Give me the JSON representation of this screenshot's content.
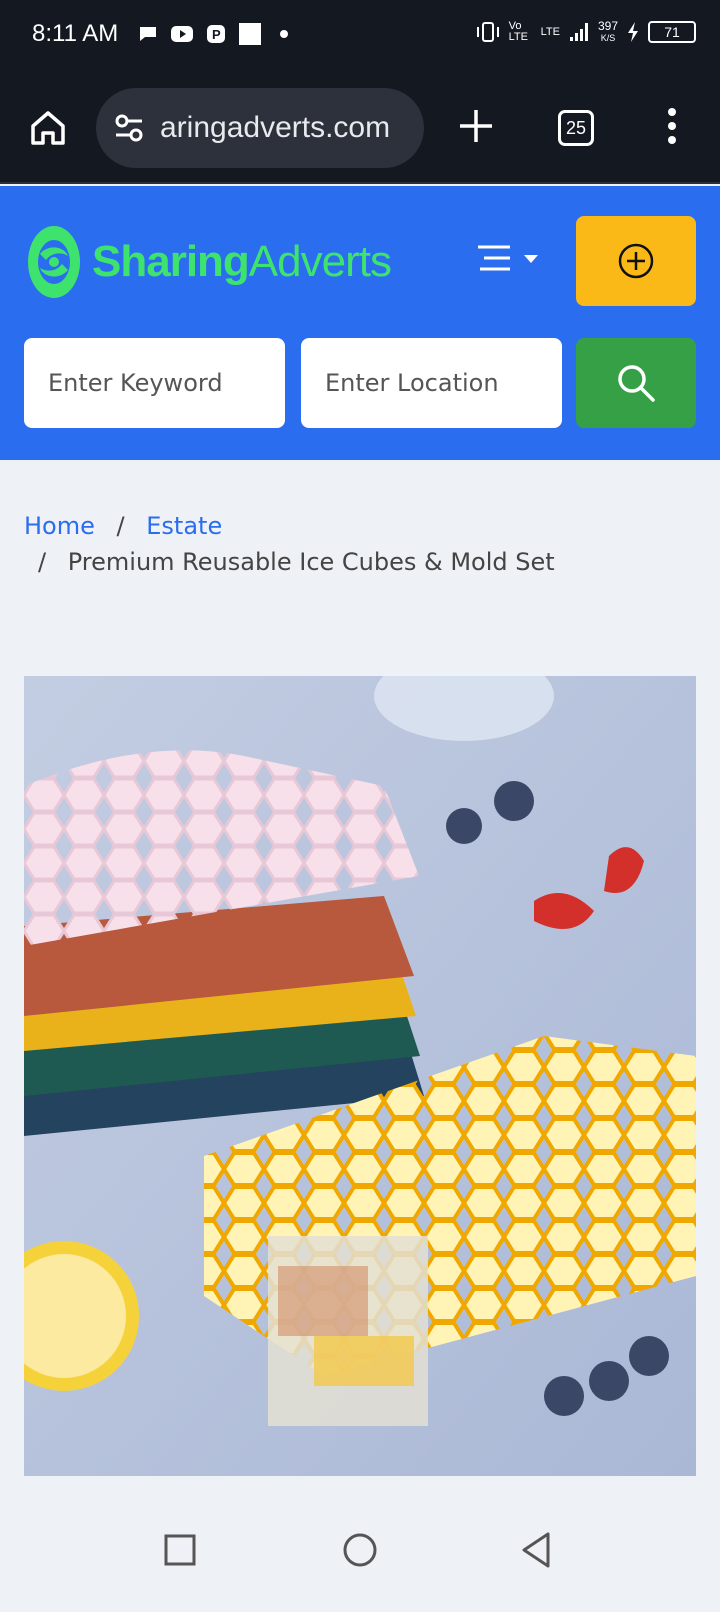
{
  "status": {
    "time": "8:11 AM",
    "battery": "71",
    "speed_value": "397",
    "speed_unit": "K/S",
    "network_1": "Vo LTE",
    "network_2": "LTE"
  },
  "browser": {
    "url": "aringadverts.com",
    "tab_count": "25"
  },
  "site": {
    "logo_part1": "Sharing",
    "logo_part2": "Adverts",
    "keyword_placeholder": "Enter Keyword",
    "location_placeholder": "Enter Location",
    "accent_blue": "#2b6def",
    "accent_yellow": "#fbb917",
    "accent_green": "#36a047"
  },
  "breadcrumb": {
    "home": "Home",
    "separator": "/",
    "category": "Estate",
    "current": "Premium Reusable Ice Cubes & Mold Set"
  },
  "product": {
    "image_icon": "honeycomb-ice-tray-photo"
  }
}
